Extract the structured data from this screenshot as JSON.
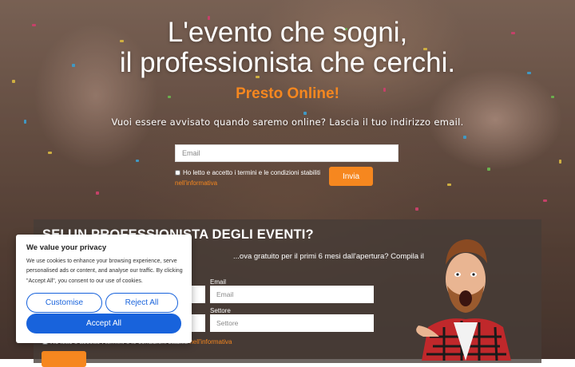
{
  "hero": {
    "title_line1": "L'evento che sogni,",
    "title_line2": "il professionista che cerchi.",
    "coming_soon": "Presto Online!",
    "subtitle": "Vuoi essere avvisato quando saremo online? Lascia il tuo indirizzo email.",
    "email_placeholder": "Email",
    "consent_text": "Ho letto e accetto i termini e le condizioni stabiliti",
    "consent_link": "nell'informativa",
    "submit_label": "Invia"
  },
  "pro_section": {
    "title": "SEI UN PROFESSIONISTA DEGLI EVENTI?",
    "text": "...ova gratuito per il primi 6 mesi dall'apertura? Compila il",
    "email_label": "Email",
    "email_placeholder": "Email",
    "sector_label": "Settore",
    "sector_placeholder": "Settore",
    "consent_text": "Ho letto e accetto i termini e le condizioni stabiliti",
    "consent_link": "nell'informativa"
  },
  "cookie_banner": {
    "title": "We value your privacy",
    "text": "We use cookies to enhance your browsing experience, serve personalised ads or content, and analyse our traffic. By clicking \"Accept All\", you consent to our use of cookies.",
    "customise_label": "Customise",
    "reject_label": "Reject All",
    "accept_label": "Accept All"
  },
  "colors": {
    "accent": "#f6871f",
    "cookie_blue": "#1863dc"
  }
}
